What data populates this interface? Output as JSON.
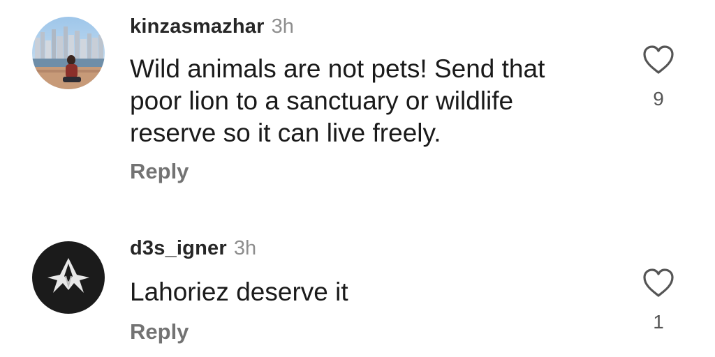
{
  "comments": [
    {
      "username": "kinzasmazhar",
      "time": "3h",
      "text_lines": [
        "Wild animals are not pets! Send that",
        "poor lion to a sanctuary or wildlife",
        "reserve so it can live freely."
      ],
      "reply_label": "Reply",
      "like_count": "9",
      "like_icon": "heart-outline-icon",
      "avatar": "profile-photo-city-skyline"
    },
    {
      "username": "d3s_igner",
      "time": "3h",
      "text_lines": [
        "Lahoriez deserve it"
      ],
      "reply_label": "Reply",
      "like_count": "1",
      "like_icon": "heart-outline-icon",
      "avatar": "logo-black-circle"
    }
  ],
  "colors": {
    "username": "#262626",
    "time": "#8e8e8e",
    "reply": "#737373",
    "text": "#1a1a1a"
  }
}
